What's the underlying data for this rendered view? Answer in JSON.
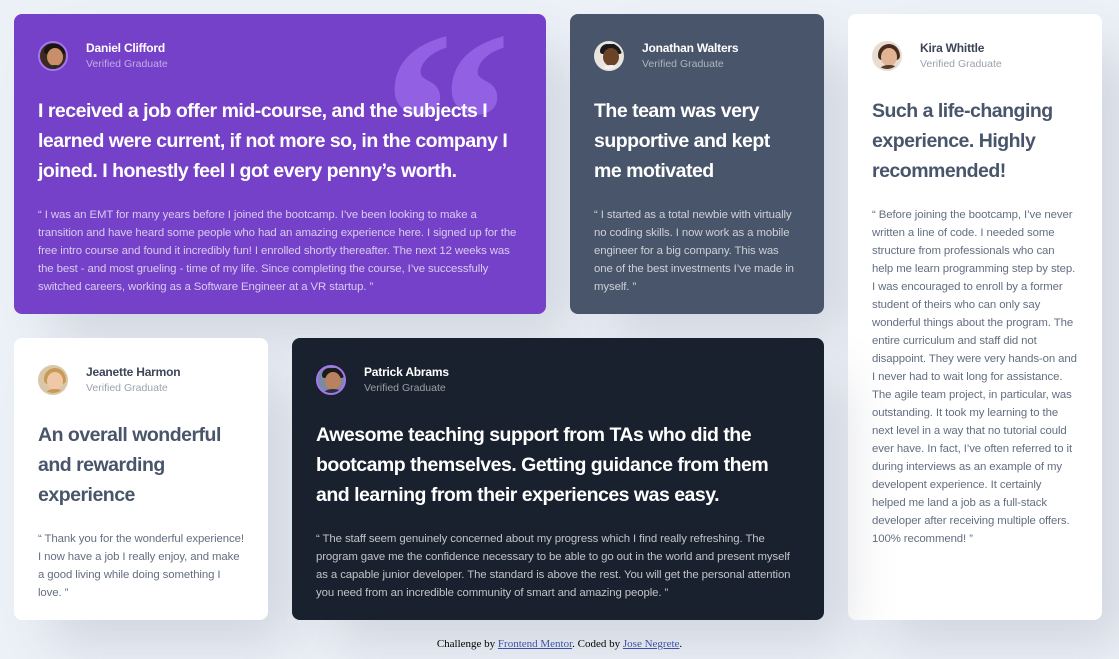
{
  "colors": {
    "page_bg": "#ecf0f7",
    "violet": "#7541c8",
    "grayish_blue": "#48556a",
    "blackish_blue": "#19212e",
    "white": "#ffffff",
    "quote_mark": "#9260e2"
  },
  "testimonials": [
    {
      "name": "Daniel Clifford",
      "role": "Verified Graduate",
      "headline": "I received a job offer mid-course, and the subjects I learned were current, if not more so, in the company I joined. I honestly feel I got every penny’s worth.",
      "body": "“ I was an EMT for many years before I joined the bootcamp. I’ve been looking to make a transition and have heard some people who had an amazing experience here. I signed up for the free intro course and found it incredibly fun! I enrolled shortly thereafter. The next 12 weeks was the best - and most grueling - time of my life. Since completing the course, I’ve successfully switched careers, working as a Software Engineer at a VR startup. ”",
      "avatar_icon": "avatar-daniel-icon"
    },
    {
      "name": "Jonathan Walters",
      "role": "Verified Graduate",
      "headline": "The team was very supportive and kept me motivated",
      "body": "“ I started as a total newbie with virtually no coding skills. I now work as a mobile engineer for a big company. This was one of the best investments I’ve made in myself. ”",
      "avatar_icon": "avatar-jonathan-icon"
    },
    {
      "name": "Kira Whittle",
      "role": "Verified Graduate",
      "headline": "Such a life-changing experience. Highly recommended!",
      "body": "“ Before joining the bootcamp, I’ve never written a line of code. I needed some structure from professionals who can help me learn programming step by step. I was encouraged to enroll by a former student of theirs who can only say wonderful things about the program. The entire curriculum and staff did not disappoint. They were very hands-on and I never had to wait long for assistance. The agile team project, in particular, was outstanding. It took my learning to the next level in a way that no tutorial could ever have. In fact, I’ve often referred to it during interviews as an example of my developent experience. It certainly helped me land a job as a full-stack developer after receiving multiple offers. 100% recommend! ”",
      "avatar_icon": "avatar-kira-icon"
    },
    {
      "name": "Jeanette Harmon",
      "role": "Verified Graduate",
      "headline": "An overall wonderful and rewarding experience",
      "body": "“ Thank you for the wonderful experience! I now have a job I really enjoy, and make a good living while doing something I love. ”",
      "avatar_icon": "avatar-jeanette-icon"
    },
    {
      "name": "Patrick Abrams",
      "role": "Verified Graduate",
      "headline": "Awesome teaching support from TAs who did the bootcamp themselves. Getting guidance from them and learning from their experiences was easy.",
      "body": "“ The staff seem genuinely concerned about my progress which I find really refreshing. The program gave me the confidence necessary to be able to go out in the world and present myself as a capable junior developer. The standard is above the rest. You will get the personal attention you need from an incredible community of smart and amazing people. ”",
      "avatar_icon": "avatar-patrick-icon"
    }
  ],
  "attribution": {
    "prefix": "Challenge by ",
    "link1": "Frontend Mentor",
    "middle": ". Coded by ",
    "link2": "Jose Negrete",
    "suffix": "."
  }
}
